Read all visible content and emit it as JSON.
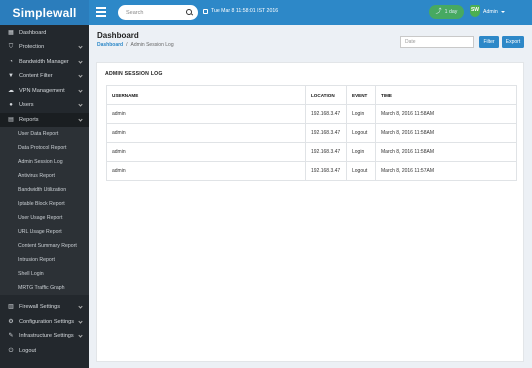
{
  "topbar": {
    "brand": "Simplewall",
    "search_placeholder": "Search",
    "datetime": "Tue Mar 8 11:58:01 IST 2016",
    "period_label": "1 day",
    "user_label": "Admin",
    "user_badge": "SW"
  },
  "sidebar": {
    "items": [
      {
        "label": "Dashboard",
        "icon": "grid-icon"
      },
      {
        "label": "Protection",
        "icon": "shield-icon"
      },
      {
        "label": "Bandwidth Manager",
        "icon": "gauge-icon"
      },
      {
        "label": "Content Filter",
        "icon": "filter-icon"
      },
      {
        "label": "VPN Management",
        "icon": "cloud-icon"
      },
      {
        "label": "Users",
        "icon": "user-icon"
      },
      {
        "label": "Reports",
        "icon": "document-icon"
      }
    ],
    "report_subitems": [
      "User Data Report",
      "Data Protocol Report",
      "Admin Session Log",
      "Antivirus Report",
      "Bandwidth Utilization",
      "Iptable Block Report",
      "User Usage Report",
      "URL Usage Report",
      "Content Summary Report",
      "Intrusion Report",
      "Shell Login",
      "MRTG Traffic Graph"
    ],
    "bottom_items": [
      {
        "label": "Firewall Settings",
        "icon": "firewall-icon"
      },
      {
        "label": "Configuration Settings",
        "icon": "gear-icon"
      },
      {
        "label": "Infrastructure Settings",
        "icon": "wrench-icon"
      },
      {
        "label": "Logout",
        "icon": "power-icon"
      }
    ]
  },
  "main": {
    "title": "Dashboard",
    "breadcrumb_home": "Dashboard",
    "breadcrumb_sep": "/",
    "breadcrumb_current": "Admin Session Log",
    "date_placeholder": "Date",
    "filter_label": "Filter",
    "export_label": "Export",
    "panel_title": "ADMIN SESSION LOG",
    "columns": [
      "USERNAME",
      "LOCATION",
      "EVENT",
      "TIME"
    ],
    "rows": [
      [
        "admin",
        "192.168.3.47",
        "Login",
        "March 8, 2016 11:58AM"
      ],
      [
        "admin",
        "192.168.3.47",
        "Logout",
        "March 8, 2016 11:58AM"
      ],
      [
        "admin",
        "192.168.3.47",
        "Login",
        "March 8, 2016 11:58AM"
      ],
      [
        "admin",
        "192.168.3.47",
        "Logout",
        "March 8, 2016 11:57AM"
      ]
    ]
  },
  "colors": {
    "topbar": "#2d88c8",
    "sidebar": "#23282d",
    "accent": "#2d88c8",
    "success": "#4caf50"
  }
}
